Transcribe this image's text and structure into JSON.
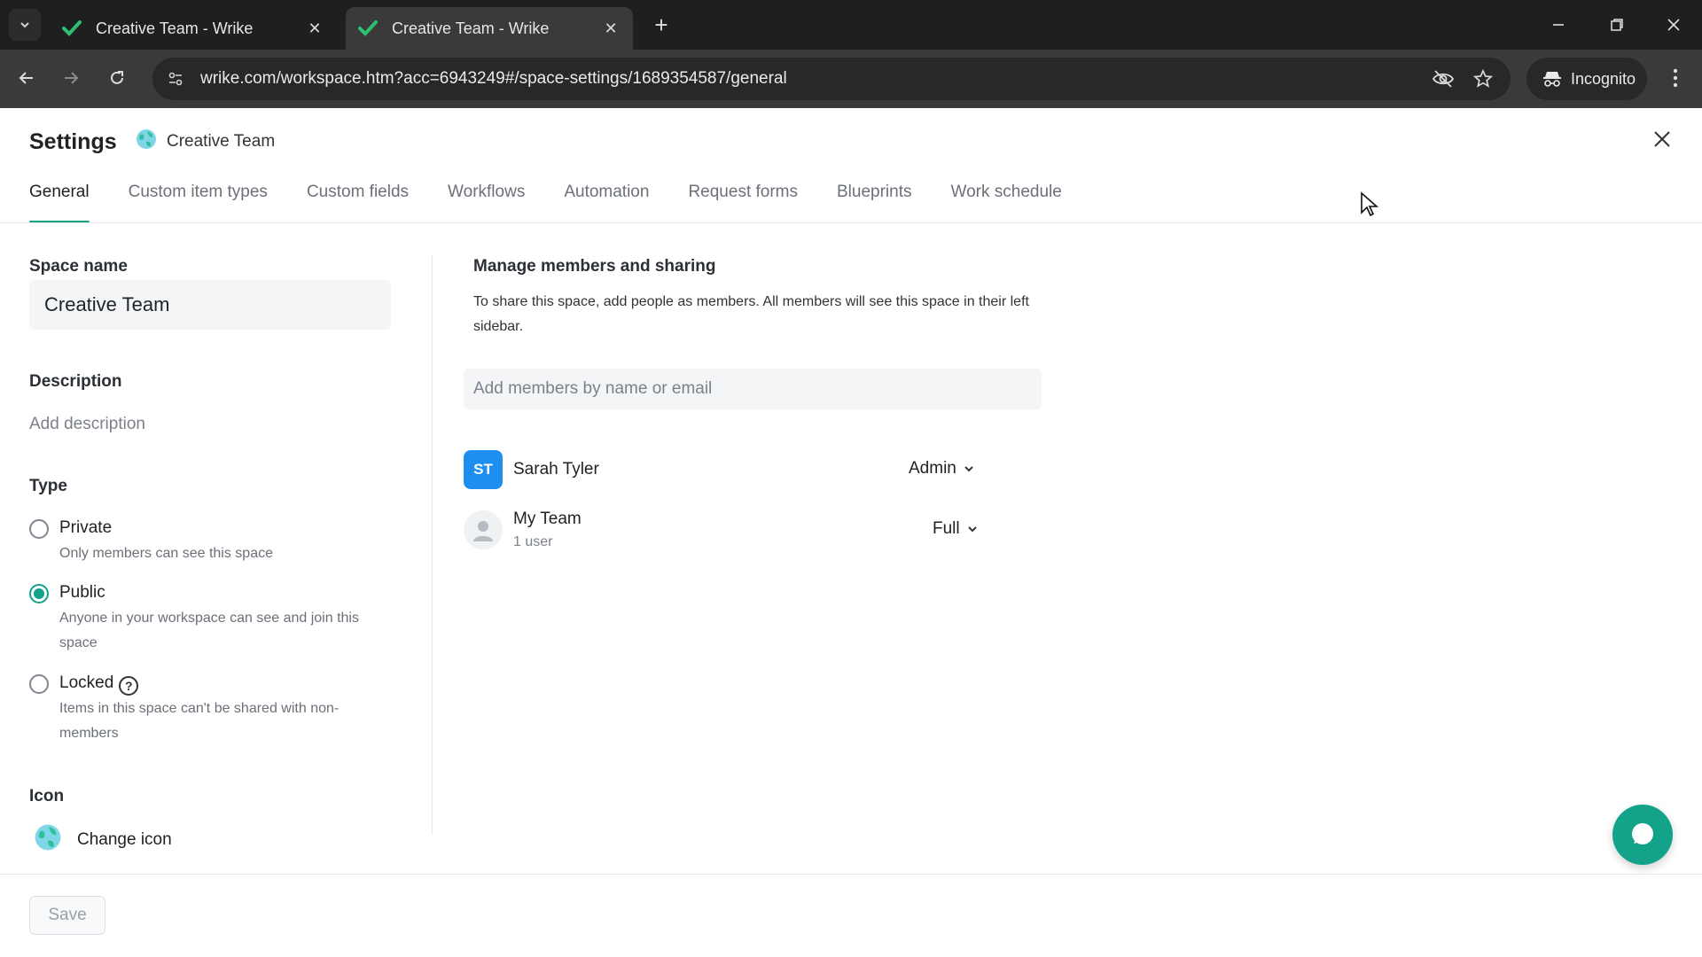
{
  "browser": {
    "tabs": [
      {
        "title": "Creative Team - Wrike",
        "active": false
      },
      {
        "title": "Creative Team - Wrike",
        "active": true
      }
    ],
    "url": "wrike.com/workspace.htm?acc=6943249#/space-settings/1689354587/general",
    "incognito_label": "Incognito",
    "accent": "#13a38b"
  },
  "header": {
    "title": "Settings",
    "space_name": "Creative Team"
  },
  "tabs": [
    "General",
    "Custom item types",
    "Custom fields",
    "Workflows",
    "Automation",
    "Request forms",
    "Blueprints",
    "Work schedule"
  ],
  "left": {
    "space_name_label": "Space name",
    "space_name_value": "Creative Team",
    "description_label": "Description",
    "description_placeholder": "Add description",
    "type_label": "Type",
    "types": [
      {
        "title": "Private",
        "desc": "Only members can see this space",
        "checked": false
      },
      {
        "title": "Public",
        "desc": "Anyone in your workspace can see and join this space",
        "checked": true
      },
      {
        "title": "Locked",
        "desc": "Items in this space can't be shared with non-members",
        "checked": false
      }
    ],
    "icon_label": "Icon",
    "change_icon_label": "Change icon"
  },
  "members": {
    "title": "Manage members and sharing",
    "description": "To share this space, add people as members. All members will see this space in their left sidebar.",
    "input_placeholder": "Add members by name or email",
    "list": [
      {
        "initials": "ST",
        "name": "Sarah Tyler",
        "sub": "",
        "role": "Admin"
      },
      {
        "initials": "",
        "name": "My Team",
        "sub": "1 user",
        "role": "Full"
      }
    ]
  },
  "footer": {
    "save_label": "Save"
  }
}
